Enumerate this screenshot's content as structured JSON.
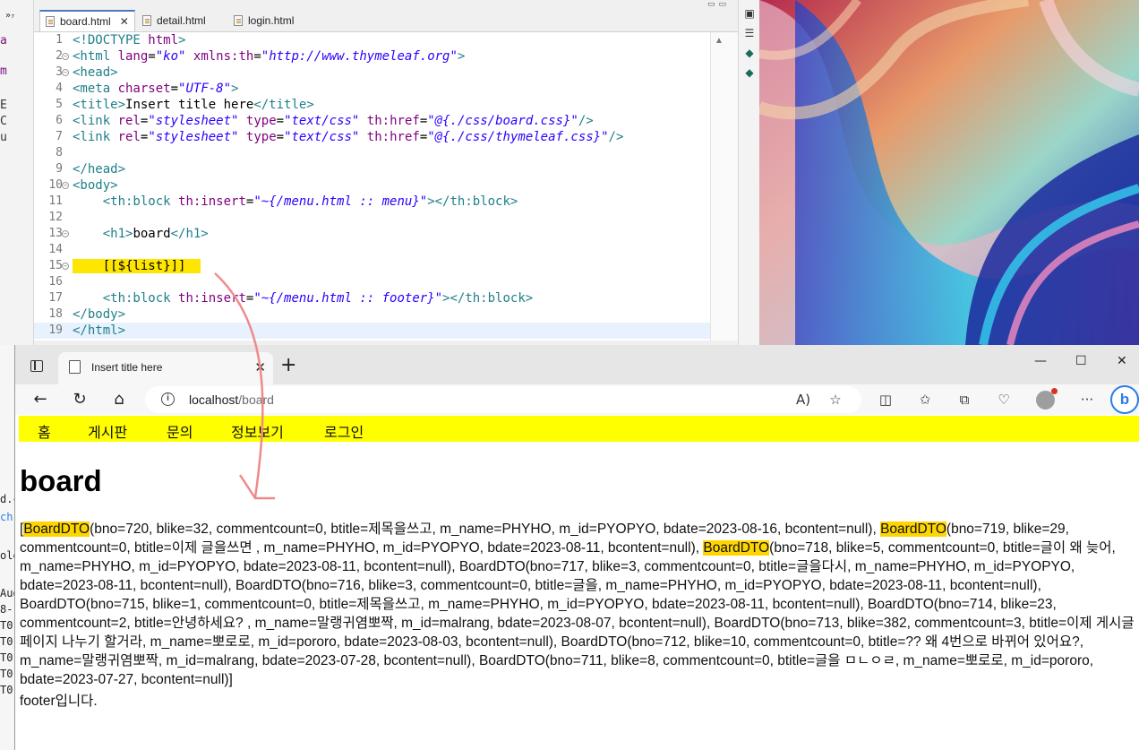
{
  "ide": {
    "tabs": [
      {
        "label": "board.html",
        "active": true
      },
      {
        "label": "detail.html",
        "active": false
      },
      {
        "label": "login.html",
        "active": false
      }
    ],
    "left_fragments": [
      "a",
      "m",
      "E",
      "C",
      "u"
    ],
    "left_chevron": "»₇",
    "code_lines": [
      {
        "n": "1",
        "fold": false,
        "segs": [
          [
            "tag",
            "<!DOCTYPE "
          ],
          [
            "attr",
            "html"
          ],
          [
            "tag",
            ">"
          ]
        ]
      },
      {
        "n": "2",
        "fold": true,
        "segs": [
          [
            "tag",
            "<html "
          ],
          [
            "attr",
            "lang"
          ],
          [
            "plain",
            "="
          ],
          [
            "val",
            "\"ko\""
          ],
          [
            "plain",
            " "
          ],
          [
            "attr",
            "xmlns:th"
          ],
          [
            "plain",
            "="
          ],
          [
            "val",
            "\"http://www.thymeleaf.org\""
          ],
          [
            "tag",
            ">"
          ]
        ]
      },
      {
        "n": "3",
        "fold": true,
        "segs": [
          [
            "tag",
            "<head>"
          ]
        ]
      },
      {
        "n": "4",
        "fold": false,
        "segs": [
          [
            "tag",
            "<meta "
          ],
          [
            "attr",
            "charset"
          ],
          [
            "plain",
            "="
          ],
          [
            "val",
            "\"UTF-8\""
          ],
          [
            "tag",
            ">"
          ]
        ]
      },
      {
        "n": "5",
        "fold": false,
        "segs": [
          [
            "tag",
            "<title>"
          ],
          [
            "plain",
            "Insert title here"
          ],
          [
            "tag",
            "</title>"
          ]
        ]
      },
      {
        "n": "6",
        "fold": false,
        "segs": [
          [
            "tag",
            "<link "
          ],
          [
            "attr",
            "rel"
          ],
          [
            "plain",
            "="
          ],
          [
            "val",
            "\"stylesheet\""
          ],
          [
            "plain",
            " "
          ],
          [
            "attr",
            "type"
          ],
          [
            "plain",
            "="
          ],
          [
            "val",
            "\"text/css\""
          ],
          [
            "plain",
            " "
          ],
          [
            "attr",
            "th:href"
          ],
          [
            "plain",
            "="
          ],
          [
            "val",
            "\"@{./css/board.css}\""
          ],
          [
            "tag",
            "/>"
          ]
        ]
      },
      {
        "n": "7",
        "fold": false,
        "segs": [
          [
            "tag",
            "<link "
          ],
          [
            "attr",
            "rel"
          ],
          [
            "plain",
            "="
          ],
          [
            "val",
            "\"stylesheet\""
          ],
          [
            "plain",
            " "
          ],
          [
            "attr",
            "type"
          ],
          [
            "plain",
            "="
          ],
          [
            "val",
            "\"text/css\""
          ],
          [
            "plain",
            " "
          ],
          [
            "attr",
            "th:href"
          ],
          [
            "plain",
            "="
          ],
          [
            "val",
            "\"@{./css/thymeleaf.css}\""
          ],
          [
            "tag",
            "/>"
          ]
        ]
      },
      {
        "n": "8",
        "fold": false,
        "segs": []
      },
      {
        "n": "9",
        "fold": false,
        "segs": [
          [
            "tag",
            "</head>"
          ]
        ]
      },
      {
        "n": "10",
        "fold": true,
        "segs": [
          [
            "tag",
            "<body>"
          ]
        ]
      },
      {
        "n": "11",
        "fold": false,
        "segs": [
          [
            "plain",
            "    "
          ],
          [
            "tag",
            "<th:block "
          ],
          [
            "attr",
            "th:insert"
          ],
          [
            "plain",
            "="
          ],
          [
            "val",
            "\"~{/menu.html :: menu}\""
          ],
          [
            "tag",
            "></th:block>"
          ]
        ]
      },
      {
        "n": "12",
        "fold": false,
        "segs": []
      },
      {
        "n": "13",
        "fold": true,
        "segs": [
          [
            "plain",
            "    "
          ],
          [
            "tag",
            "<h1>"
          ],
          [
            "plain",
            "board"
          ],
          [
            "tag",
            "</h1>"
          ]
        ]
      },
      {
        "n": "14",
        "fold": false,
        "segs": []
      },
      {
        "n": "15",
        "fold": true,
        "segs": [
          [
            "hl",
            "    [[${list}]]  "
          ]
        ]
      },
      {
        "n": "16",
        "fold": false,
        "segs": []
      },
      {
        "n": "17",
        "fold": false,
        "segs": [
          [
            "plain",
            "    "
          ],
          [
            "tag",
            "<th:block "
          ],
          [
            "attr",
            "th:insert"
          ],
          [
            "plain",
            "="
          ],
          [
            "val",
            "\"~{/menu.html :: footer}\""
          ],
          [
            "tag",
            "></th:block>"
          ]
        ]
      },
      {
        "n": "18",
        "fold": false,
        "segs": [
          [
            "tag",
            "</body>"
          ]
        ]
      },
      {
        "n": "19",
        "fold": false,
        "segs": [
          [
            "tag",
            "</html>"
          ]
        ]
      }
    ]
  },
  "browser": {
    "tab_title": "Insert title here",
    "url_host": "localhost",
    "url_path": "/board",
    "menu": [
      "홈",
      "게시판",
      "문의",
      "정보보기",
      "로그인"
    ],
    "heading": "board",
    "list_parts": [
      [
        "n",
        "["
      ],
      [
        "m",
        "BoardDTO"
      ],
      [
        "n",
        "(bno=720, blike=32, commentcount=0, btitle=제목을쓰고, m_name=PHYHO, m_id=PYOPYO, bdate=2023-08-16, bcontent=null), "
      ],
      [
        "m",
        "BoardDTO"
      ],
      [
        "n",
        "(bno=719, blike=29, commentcount=0, btitle=이제 글을쓰면 , m_name=PHYHO, m_id=PYOPYO, bdate=2023-08-11, bcontent=null), "
      ],
      [
        "m",
        "BoardDTO"
      ],
      [
        "n",
        "(bno=718, blike=5, commentcount=0, btitle=글이 왜 늦어, m_name=PHYHO, m_id=PYOPYO, bdate=2023-08-11, bcontent=null), BoardDTO(bno=717, blike=3, commentcount=0, btitle=글을다시, m_name=PHYHO, m_id=PYOPYO, bdate=2023-08-11, bcontent=null), BoardDTO(bno=716, blike=3, commentcount=0, btitle=글을, m_name=PHYHO, m_id=PYOPYO, bdate=2023-08-11, bcontent=null), BoardDTO(bno=715, blike=1, commentcount=0, btitle=제목을쓰고, m_name=PHYHO, m_id=PYOPYO, bdate=2023-08-11, bcontent=null), BoardDTO(bno=714, blike=23, commentcount=2, btitle=안녕하세요? , m_name=말랭귀염뽀짝, m_id=malrang, bdate=2023-08-07, bcontent=null), BoardDTO(bno=713, blike=382, commentcount=3, btitle=이제 게시글 페이지 나누기 할거라, m_name=뽀로로, m_id=pororo, bdate=2023-08-03, bcontent=null), BoardDTO(bno=712, blike=10, commentcount=0, btitle=?? 왜 4번으로 바뀌어 있어요?, m_name=말랭귀염뽀짝, m_id=malrang, bdate=2023-07-28, bcontent=null), BoardDTO(bno=711, blike=8, commentcount=0, btitle=글을 ㅁㄴㅇㄹ, m_name=뽀로로, m_id=pororo, bdate=2023-07-27, bcontent=null)]"
      ]
    ],
    "footer": "footer입니다."
  },
  "behind_fragments": [
    "d.cs",
    "ch",
    "ole",
    "Aug",
    "8-",
    "T0",
    "T0",
    "T0",
    "T0",
    "T0"
  ],
  "colors": {
    "menu_bar": "#ffff00",
    "highlight": "#ffd500",
    "code_highlight": "#ffe600",
    "edge_accent": "#2b7de9"
  },
  "icons": [
    "back-arrow-icon",
    "refresh-icon",
    "home-icon",
    "info-icon",
    "read-aloud-icon",
    "favorite-star-icon",
    "split-screen-icon",
    "favorites-icon",
    "collections-icon",
    "browser-essentials-icon",
    "profile-avatar-icon",
    "more-icon",
    "bing-copilot-icon",
    "minimize-icon",
    "maximize-icon",
    "close-icon"
  ]
}
